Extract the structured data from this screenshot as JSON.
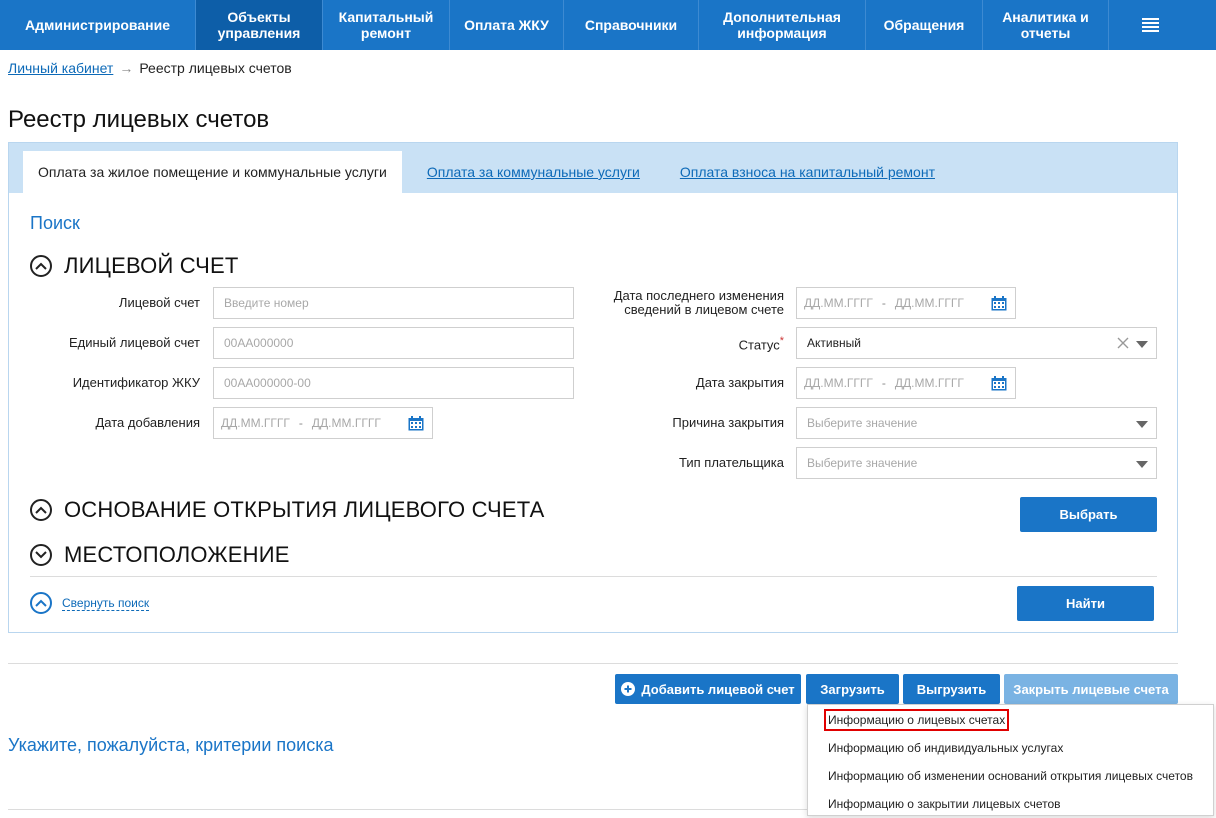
{
  "nav": {
    "items": [
      {
        "label": "Администрирование",
        "active": false
      },
      {
        "label": "Объекты управления",
        "active": true
      },
      {
        "label": "Капитальный ремонт",
        "active": false
      },
      {
        "label": "Оплата ЖКУ",
        "active": false
      },
      {
        "label": "Справочники",
        "active": false
      },
      {
        "label": "Дополнительная информация",
        "active": false
      },
      {
        "label": "Обращения",
        "active": false
      },
      {
        "label": "Аналитика и отчеты",
        "active": false
      }
    ],
    "menu_icon": "hamburger-icon"
  },
  "breadcrumb": {
    "home": "Личный кабинет",
    "separator": "→",
    "current": "Реестр лицевых счетов"
  },
  "page_title": "Реестр лицевых счетов",
  "tabs": [
    {
      "label": "Оплата за жилое помещение и коммунальные услуги",
      "active": true
    },
    {
      "label": "Оплата за коммунальные услуги",
      "active": false
    },
    {
      "label": "Оплата взноса на капитальный ремонт",
      "active": false
    }
  ],
  "search": {
    "title": "Поиск",
    "section_account": "Лицевой счет",
    "section_basis": "Основание открытия лицевого счета",
    "section_location": "Местоположение",
    "fields": {
      "account_label": "Лицевой счет",
      "account_placeholder": "Введите номер",
      "unified_label": "Единый лицевой счет",
      "unified_placeholder": "00АА000000",
      "jku_label": "Идентификатор ЖКУ",
      "jku_placeholder": "00АА000000-00",
      "added_label": "Дата добавления",
      "date_placeholder": "ДД.ММ.ГГГГ",
      "date_dash": "-",
      "last_change_label_1": "Дата последнего изменения",
      "last_change_label_2": "сведений в лицевом счете",
      "status_label": "Статус",
      "status_required": "*",
      "status_value": "Активный",
      "closed_label": "Дата закрытия",
      "reason_label": "Причина закрытия",
      "reason_placeholder": "Выберите значение",
      "payer_label": "Тип плательщика",
      "payer_placeholder": "Выберите значение"
    },
    "select_button": "Выбрать",
    "collapse_label": "Свернуть поиск",
    "find_button": "Найти"
  },
  "actions": {
    "add": "Добавить лицевой счет",
    "upload": "Загрузить",
    "download": "Выгрузить",
    "close": "Закрыть лицевые счета"
  },
  "download_menu": [
    {
      "label": "Информацию о лицевых счетах",
      "highlighted": true
    },
    {
      "label": "Информацию об индивидуальных услугах",
      "highlighted": false
    },
    {
      "label": "Информацию об изменении оснований открытия лицевых счетов",
      "highlighted": false
    },
    {
      "label": "Информацию о закрытии лицевых счетов",
      "highlighted": false
    }
  ],
  "hint": "Укажите, пожалуйста, критерии поиска",
  "colors": {
    "primary": "#1a75c7",
    "nav_active": "#0d5ea8",
    "tab_bar": "#c9e1f5",
    "disabled": "#7ab3e3",
    "highlight_outline": "#e00000"
  }
}
